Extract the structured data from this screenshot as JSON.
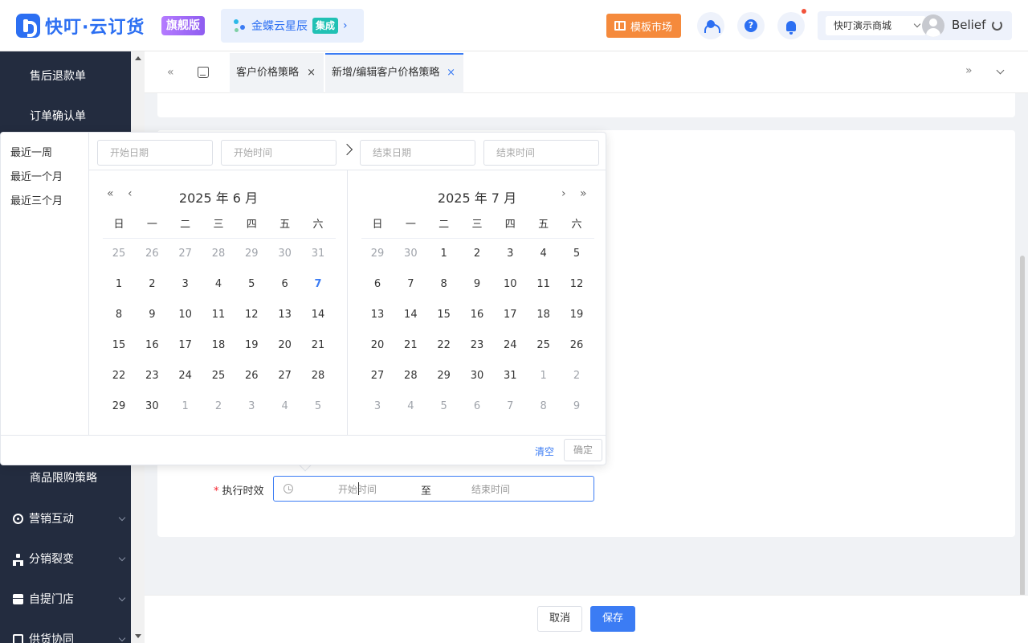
{
  "header": {
    "logo_text": "快叮·云订货",
    "edition": "旗舰版",
    "kingdee_text": "金蝶云星辰",
    "kingdee_tag": "集成",
    "kingdee_arrow": "›",
    "template_market": "模板市场",
    "help_glyph": "?",
    "store": "快叮演示商城",
    "user": "Belief"
  },
  "sidebar": {
    "sub_items": [
      "售后退款单",
      "订单确认单",
      "商品限购策略"
    ],
    "groups": [
      {
        "label": "营销互动",
        "icon": "target-icon"
      },
      {
        "label": "分销裂变",
        "icon": "network-icon"
      },
      {
        "label": "自提门店",
        "icon": "store-icon"
      },
      {
        "label": "供货协同",
        "icon": "supply-icon"
      }
    ]
  },
  "tabs": {
    "nav_left": "«",
    "nav_right": "»",
    "items": [
      {
        "label": "客户价格策略",
        "close": "×"
      },
      {
        "label": "新增/编辑客户价格策略",
        "close": "×",
        "active": true
      }
    ]
  },
  "form": {
    "required_mark": "*",
    "label": "执行时效",
    "start_placeholder": "开始时间",
    "separator": "至",
    "end_placeholder": "结束时间"
  },
  "footer": {
    "cancel": "取消",
    "save": "保存"
  },
  "picker": {
    "shortcuts": [
      "最近一周",
      "最近一个月",
      "最近三个月"
    ],
    "start_date_ph": "开始日期",
    "start_time_ph": "开始时间",
    "end_date_ph": "结束日期",
    "end_time_ph": "结束时间",
    "nav": {
      "prev_year": "«",
      "prev_month": "‹",
      "next_month": "›",
      "next_year": "»"
    },
    "weekdays": [
      "日",
      "一",
      "二",
      "三",
      "四",
      "五",
      "六"
    ],
    "left": {
      "title": "2025 年 6 月",
      "days": [
        [
          "25",
          "26",
          "27",
          "28",
          "29",
          "30",
          "31"
        ],
        [
          "1",
          "2",
          "3",
          "4",
          "5",
          "6",
          "7"
        ],
        [
          "8",
          "9",
          "10",
          "11",
          "12",
          "13",
          "14"
        ],
        [
          "15",
          "16",
          "17",
          "18",
          "19",
          "20",
          "21"
        ],
        [
          "22",
          "23",
          "24",
          "25",
          "26",
          "27",
          "28"
        ],
        [
          "29",
          "30",
          "1",
          "2",
          "3",
          "4",
          "5"
        ]
      ],
      "muted_first_row": 7,
      "muted_last_row_from": 2,
      "today": "7"
    },
    "right": {
      "title": "2025 年 7 月",
      "days": [
        [
          "29",
          "30",
          "1",
          "2",
          "3",
          "4",
          "5"
        ],
        [
          "6",
          "7",
          "8",
          "9",
          "10",
          "11",
          "12"
        ],
        [
          "13",
          "14",
          "15",
          "16",
          "17",
          "18",
          "19"
        ],
        [
          "20",
          "21",
          "22",
          "23",
          "24",
          "25",
          "26"
        ],
        [
          "27",
          "28",
          "29",
          "30",
          "31",
          "1",
          "2"
        ],
        [
          "3",
          "4",
          "5",
          "6",
          "7",
          "8",
          "9"
        ]
      ],
      "muted_first_row": 2,
      "muted_fifth_row_from": 5,
      "muted_last_row_from": 0
    },
    "clear": "清空",
    "confirm": "确定"
  }
}
